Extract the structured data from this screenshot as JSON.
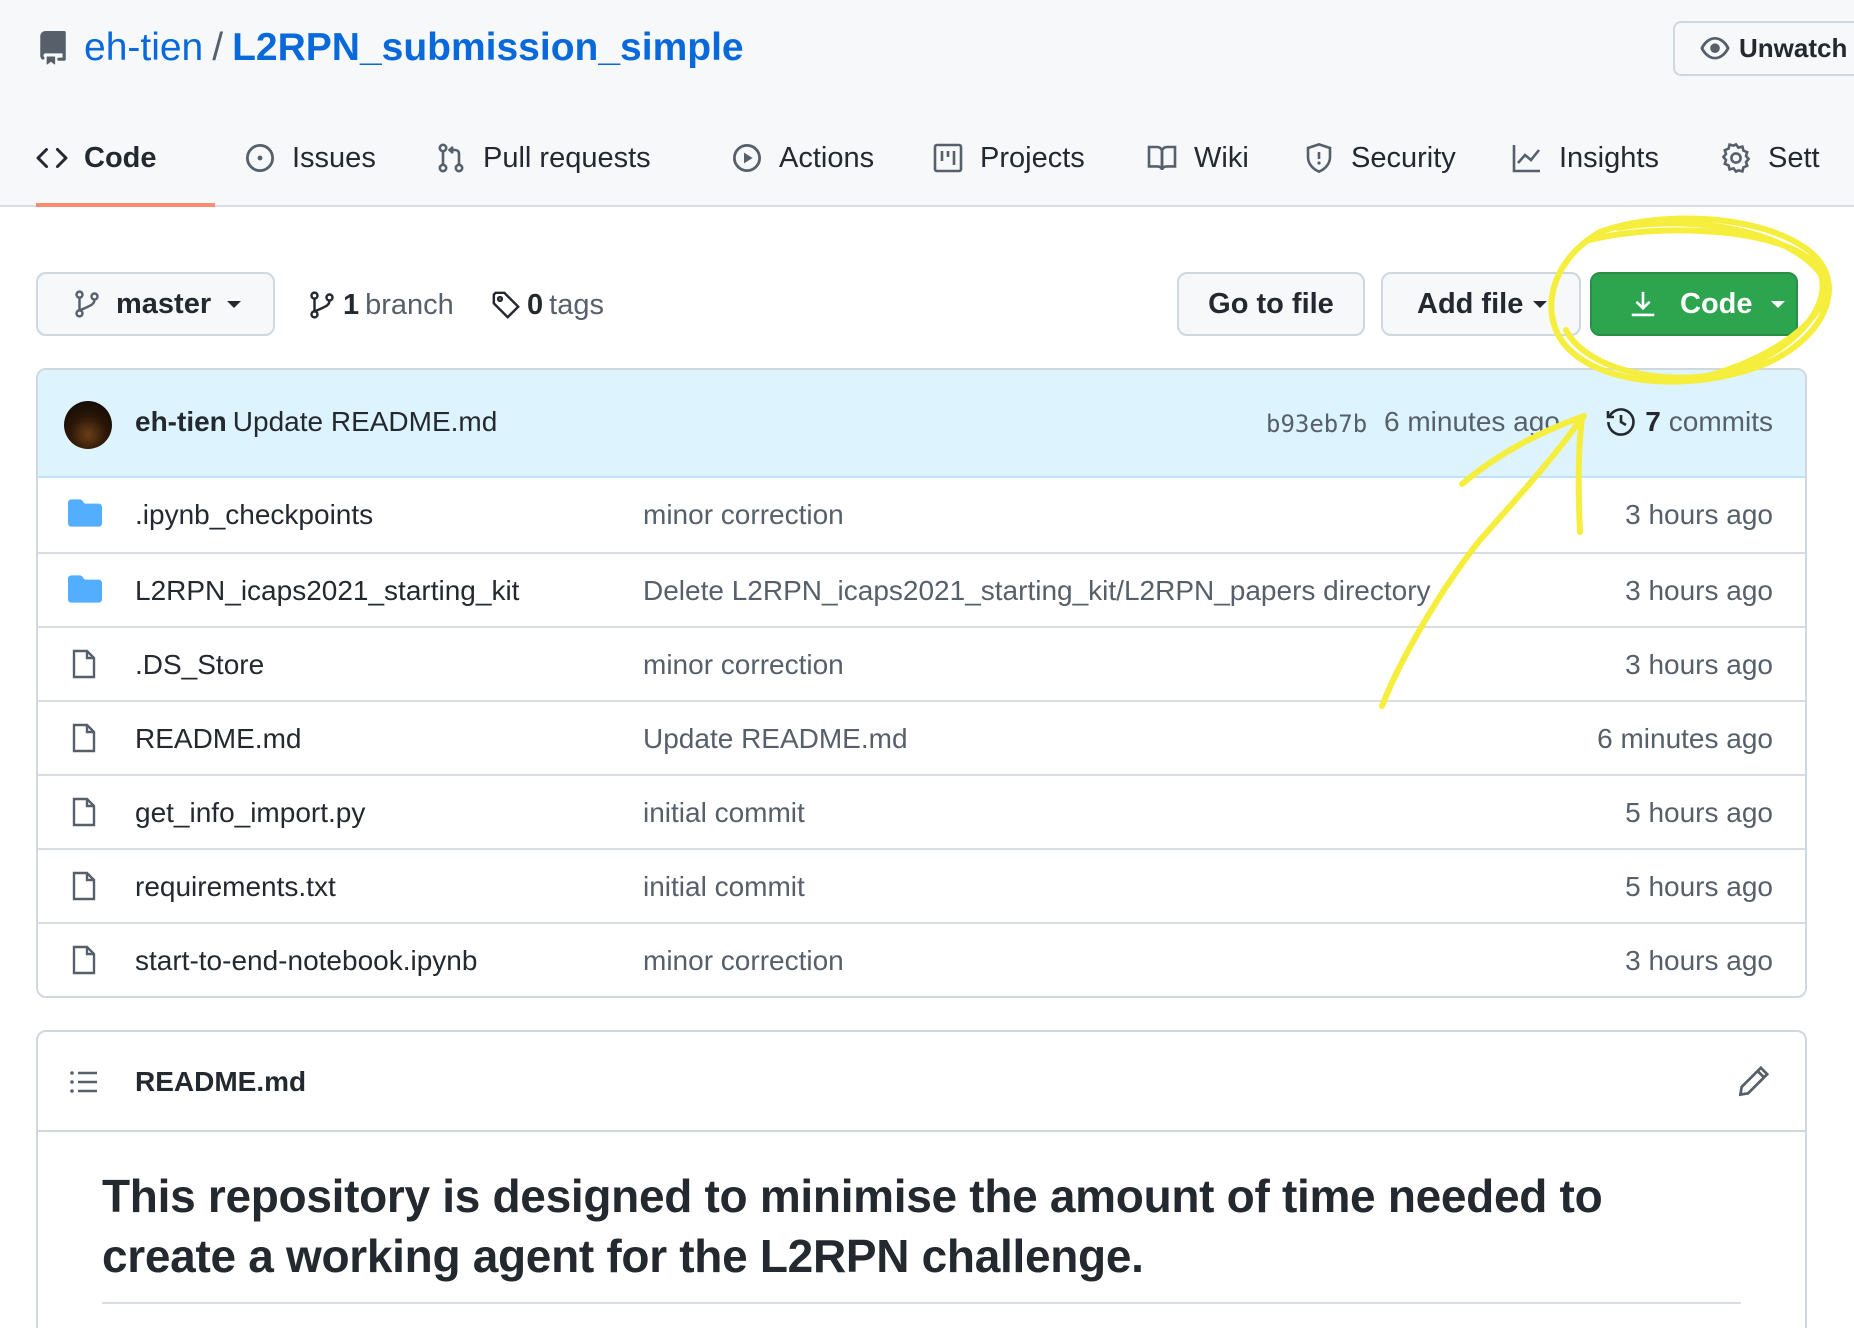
{
  "repo": {
    "owner": "eh-tien",
    "separator": "/",
    "name": "L2RPN_submission_simple",
    "unwatch_label": "Unwatch"
  },
  "tabs": [
    {
      "label": "Code",
      "icon": "code-icon",
      "active": true
    },
    {
      "label": "Issues",
      "icon": "issue-icon"
    },
    {
      "label": "Pull requests",
      "icon": "pull-request-icon"
    },
    {
      "label": "Actions",
      "icon": "play-icon"
    },
    {
      "label": "Projects",
      "icon": "project-icon"
    },
    {
      "label": "Wiki",
      "icon": "book-icon"
    },
    {
      "label": "Security",
      "icon": "shield-icon"
    },
    {
      "label": "Insights",
      "icon": "graph-icon"
    },
    {
      "label": "Sett",
      "icon": "gear-icon"
    }
  ],
  "toolbar": {
    "branch_select": "master",
    "branch_count": "1",
    "branch_label": "branch",
    "tag_count": "0",
    "tag_label": "tags",
    "go_to_file": "Go to file",
    "add_file": "Add file",
    "code_button": "Code"
  },
  "latest_commit": {
    "author": "eh-tien",
    "message": "Update README.md",
    "sha": "b93eb7b",
    "time": "6 minutes ago",
    "commit_count": "7",
    "commits_label": "commits"
  },
  "files": [
    {
      "type": "dir",
      "name": ".ipynb_checkpoints",
      "message": "minor correction",
      "age": "3 hours ago"
    },
    {
      "type": "dir",
      "name": "L2RPN_icaps2021_starting_kit",
      "message": "Delete L2RPN_icaps2021_starting_kit/L2RPN_papers directory",
      "age": "3 hours ago"
    },
    {
      "type": "file",
      "name": ".DS_Store",
      "message": "minor correction",
      "age": "3 hours ago"
    },
    {
      "type": "file",
      "name": "README.md",
      "message": "Update README.md",
      "age": "6 minutes ago"
    },
    {
      "type": "file",
      "name": "get_info_import.py",
      "message": "initial commit",
      "age": "5 hours ago"
    },
    {
      "type": "file",
      "name": "requirements.txt",
      "message": "initial commit",
      "age": "5 hours ago"
    },
    {
      "type": "file",
      "name": "start-to-end-notebook.ipynb",
      "message": "minor correction",
      "age": "3 hours ago"
    }
  ],
  "readme": {
    "title": "README.md",
    "heading": "This repository is designed to minimise the amount of time needed to create a working agent for the L2RPN challenge."
  },
  "colors": {
    "link": "#0969da",
    "code_button": "#2da44e",
    "active_tab_underline": "#fd8c73",
    "commit_bar": "#ddf4ff",
    "folder": "#54aeff",
    "annotation": "#f5ee3d"
  }
}
